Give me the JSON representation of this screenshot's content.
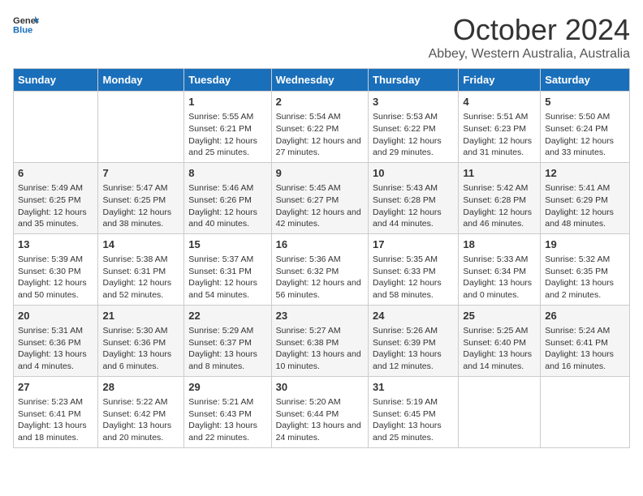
{
  "logo": {
    "text_general": "General",
    "text_blue": "Blue"
  },
  "title": "October 2024",
  "location": "Abbey, Western Australia, Australia",
  "days_of_week": [
    "Sunday",
    "Monday",
    "Tuesday",
    "Wednesday",
    "Thursday",
    "Friday",
    "Saturday"
  ],
  "weeks": [
    [
      null,
      null,
      {
        "day": "1",
        "sunrise": "Sunrise: 5:55 AM",
        "sunset": "Sunset: 6:21 PM",
        "daylight": "Daylight: 12 hours and 25 minutes."
      },
      {
        "day": "2",
        "sunrise": "Sunrise: 5:54 AM",
        "sunset": "Sunset: 6:22 PM",
        "daylight": "Daylight: 12 hours and 27 minutes."
      },
      {
        "day": "3",
        "sunrise": "Sunrise: 5:53 AM",
        "sunset": "Sunset: 6:22 PM",
        "daylight": "Daylight: 12 hours and 29 minutes."
      },
      {
        "day": "4",
        "sunrise": "Sunrise: 5:51 AM",
        "sunset": "Sunset: 6:23 PM",
        "daylight": "Daylight: 12 hours and 31 minutes."
      },
      {
        "day": "5",
        "sunrise": "Sunrise: 5:50 AM",
        "sunset": "Sunset: 6:24 PM",
        "daylight": "Daylight: 12 hours and 33 minutes."
      }
    ],
    [
      {
        "day": "6",
        "sunrise": "Sunrise: 5:49 AM",
        "sunset": "Sunset: 6:25 PM",
        "daylight": "Daylight: 12 hours and 35 minutes."
      },
      {
        "day": "7",
        "sunrise": "Sunrise: 5:47 AM",
        "sunset": "Sunset: 6:25 PM",
        "daylight": "Daylight: 12 hours and 38 minutes."
      },
      {
        "day": "8",
        "sunrise": "Sunrise: 5:46 AM",
        "sunset": "Sunset: 6:26 PM",
        "daylight": "Daylight: 12 hours and 40 minutes."
      },
      {
        "day": "9",
        "sunrise": "Sunrise: 5:45 AM",
        "sunset": "Sunset: 6:27 PM",
        "daylight": "Daylight: 12 hours and 42 minutes."
      },
      {
        "day": "10",
        "sunrise": "Sunrise: 5:43 AM",
        "sunset": "Sunset: 6:28 PM",
        "daylight": "Daylight: 12 hours and 44 minutes."
      },
      {
        "day": "11",
        "sunrise": "Sunrise: 5:42 AM",
        "sunset": "Sunset: 6:28 PM",
        "daylight": "Daylight: 12 hours and 46 minutes."
      },
      {
        "day": "12",
        "sunrise": "Sunrise: 5:41 AM",
        "sunset": "Sunset: 6:29 PM",
        "daylight": "Daylight: 12 hours and 48 minutes."
      }
    ],
    [
      {
        "day": "13",
        "sunrise": "Sunrise: 5:39 AM",
        "sunset": "Sunset: 6:30 PM",
        "daylight": "Daylight: 12 hours and 50 minutes."
      },
      {
        "day": "14",
        "sunrise": "Sunrise: 5:38 AM",
        "sunset": "Sunset: 6:31 PM",
        "daylight": "Daylight: 12 hours and 52 minutes."
      },
      {
        "day": "15",
        "sunrise": "Sunrise: 5:37 AM",
        "sunset": "Sunset: 6:31 PM",
        "daylight": "Daylight: 12 hours and 54 minutes."
      },
      {
        "day": "16",
        "sunrise": "Sunrise: 5:36 AM",
        "sunset": "Sunset: 6:32 PM",
        "daylight": "Daylight: 12 hours and 56 minutes."
      },
      {
        "day": "17",
        "sunrise": "Sunrise: 5:35 AM",
        "sunset": "Sunset: 6:33 PM",
        "daylight": "Daylight: 12 hours and 58 minutes."
      },
      {
        "day": "18",
        "sunrise": "Sunrise: 5:33 AM",
        "sunset": "Sunset: 6:34 PM",
        "daylight": "Daylight: 13 hours and 0 minutes."
      },
      {
        "day": "19",
        "sunrise": "Sunrise: 5:32 AM",
        "sunset": "Sunset: 6:35 PM",
        "daylight": "Daylight: 13 hours and 2 minutes."
      }
    ],
    [
      {
        "day": "20",
        "sunrise": "Sunrise: 5:31 AM",
        "sunset": "Sunset: 6:36 PM",
        "daylight": "Daylight: 13 hours and 4 minutes."
      },
      {
        "day": "21",
        "sunrise": "Sunrise: 5:30 AM",
        "sunset": "Sunset: 6:36 PM",
        "daylight": "Daylight: 13 hours and 6 minutes."
      },
      {
        "day": "22",
        "sunrise": "Sunrise: 5:29 AM",
        "sunset": "Sunset: 6:37 PM",
        "daylight": "Daylight: 13 hours and 8 minutes."
      },
      {
        "day": "23",
        "sunrise": "Sunrise: 5:27 AM",
        "sunset": "Sunset: 6:38 PM",
        "daylight": "Daylight: 13 hours and 10 minutes."
      },
      {
        "day": "24",
        "sunrise": "Sunrise: 5:26 AM",
        "sunset": "Sunset: 6:39 PM",
        "daylight": "Daylight: 13 hours and 12 minutes."
      },
      {
        "day": "25",
        "sunrise": "Sunrise: 5:25 AM",
        "sunset": "Sunset: 6:40 PM",
        "daylight": "Daylight: 13 hours and 14 minutes."
      },
      {
        "day": "26",
        "sunrise": "Sunrise: 5:24 AM",
        "sunset": "Sunset: 6:41 PM",
        "daylight": "Daylight: 13 hours and 16 minutes."
      }
    ],
    [
      {
        "day": "27",
        "sunrise": "Sunrise: 5:23 AM",
        "sunset": "Sunset: 6:41 PM",
        "daylight": "Daylight: 13 hours and 18 minutes."
      },
      {
        "day": "28",
        "sunrise": "Sunrise: 5:22 AM",
        "sunset": "Sunset: 6:42 PM",
        "daylight": "Daylight: 13 hours and 20 minutes."
      },
      {
        "day": "29",
        "sunrise": "Sunrise: 5:21 AM",
        "sunset": "Sunset: 6:43 PM",
        "daylight": "Daylight: 13 hours and 22 minutes."
      },
      {
        "day": "30",
        "sunrise": "Sunrise: 5:20 AM",
        "sunset": "Sunset: 6:44 PM",
        "daylight": "Daylight: 13 hours and 24 minutes."
      },
      {
        "day": "31",
        "sunrise": "Sunrise: 5:19 AM",
        "sunset": "Sunset: 6:45 PM",
        "daylight": "Daylight: 13 hours and 25 minutes."
      },
      null,
      null
    ]
  ]
}
